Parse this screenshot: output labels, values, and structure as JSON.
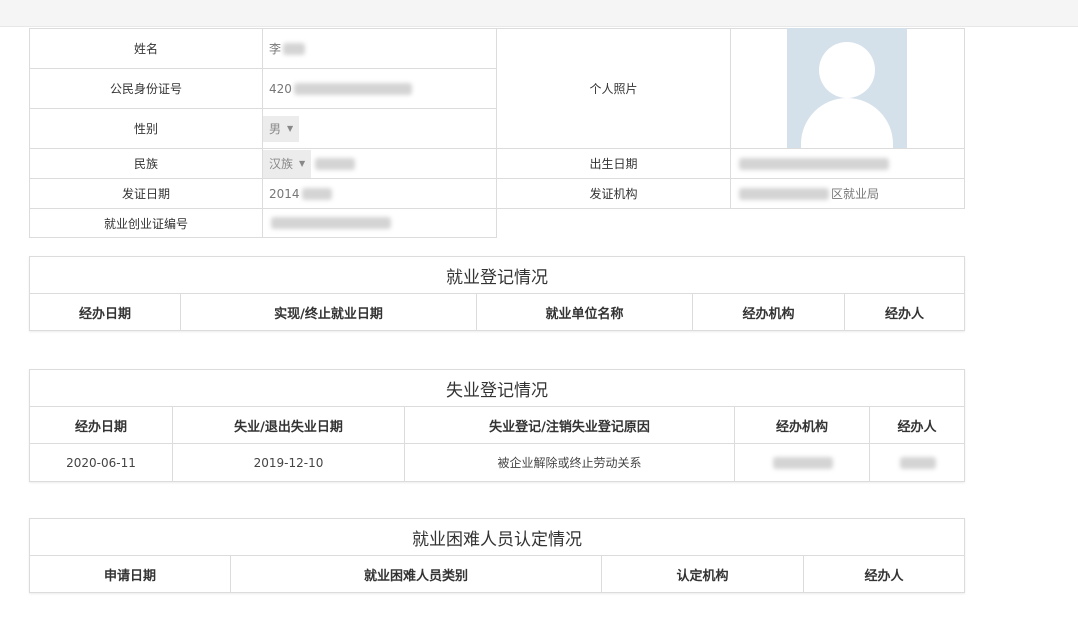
{
  "info": {
    "name_label": "姓名",
    "name_value": "李",
    "id_label": "公民身份证号",
    "id_value": "420",
    "gender_label": "性别",
    "gender_value": "男",
    "photo_label": "个人照片",
    "ethnicity_label": "民族",
    "ethnicity_value": "汉族",
    "birth_label": "出生日期",
    "issue_date_label": "发证日期",
    "issue_date_value": "2014",
    "issuer_label": "发证机构",
    "issuer_value": "区就业局",
    "cert_no_label": "就业创业证编号"
  },
  "employment": {
    "title": "就业登记情况",
    "headers": [
      "经办日期",
      "实现/终止就业日期",
      "就业单位名称",
      "经办机构",
      "经办人"
    ]
  },
  "unemployment": {
    "title": "失业登记情况",
    "headers": [
      "经办日期",
      "失业/退出失业日期",
      "失业登记/注销失业登记原因",
      "经办机构",
      "经办人"
    ],
    "rows": [
      [
        "2020-06-11",
        "2019-12-10",
        "被企业解除或终止劳动关系",
        "",
        ""
      ]
    ]
  },
  "difficulty": {
    "title": "就业困难人员认定情况",
    "headers": [
      "申请日期",
      "就业困难人员类别",
      "认定机构",
      "经办人"
    ]
  }
}
